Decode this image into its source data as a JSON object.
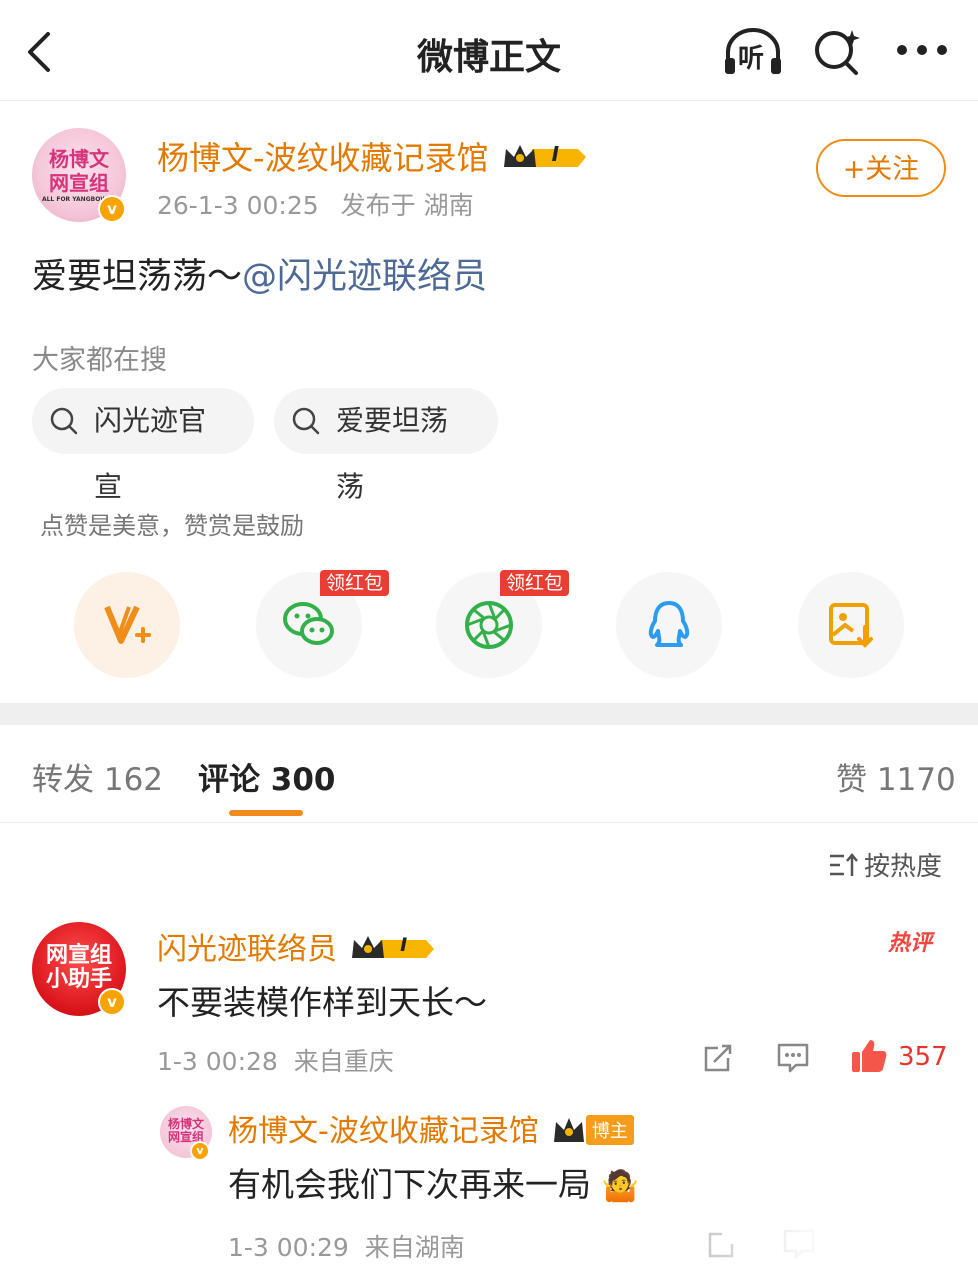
{
  "header": {
    "title": "微博正文",
    "listen_label": "听",
    "icons": [
      "back-arrow-icon",
      "listen-headphones-icon",
      "search-icon",
      "more-icon"
    ]
  },
  "post": {
    "author": "杨博文-波纹收藏记录馆",
    "avatar_text_line1": "杨博文",
    "avatar_text_line2": "网宣组",
    "avatar_text_line3": "ALL FOR YANGBOWEN",
    "verified_mark": "v",
    "level_badge": "I",
    "timestamp": "26-1-3 00:25",
    "location": "发布于 湖南",
    "follow_label": "+关注",
    "text": "爱要坦荡荡～",
    "mention": "@闪光迹联络员"
  },
  "search": {
    "label": "大家都在搜",
    "chips": [
      "闪光迹官宣",
      "爱要坦荡荡"
    ]
  },
  "reward": {
    "text": "点赞是美意，赞赏是鼓励",
    "red_packet_tag": "领红包",
    "buttons": [
      "reward-icon",
      "wechat-icon",
      "moments-icon",
      "qq-icon",
      "save-image-icon"
    ]
  },
  "tabs": {
    "repost": "转发 162",
    "comments": "评论 300",
    "likes": "赞 1170"
  },
  "sort_label": "按热度",
  "comments": [
    {
      "author": "闪光迹联络员",
      "avatar_text_line1": "网宣组",
      "avatar_text_line2": "小助手",
      "level_badge": "I",
      "hot_badge": "热评",
      "text": "不要装模作样到天长～",
      "meta": "1-3 00:28  来自重庆",
      "likes": "357",
      "reply": {
        "author": "杨博文-波纹收藏记录馆",
        "avatar_text_line1": "杨博文",
        "avatar_text_line2": "网宣组",
        "owner_badge": "博主",
        "text": "有机会我们下次再来一局",
        "emoji": "🤷",
        "meta": "1-3 00:29  来自湖南"
      }
    }
  ],
  "colors": {
    "accent_orange": "#e37a00",
    "link_blue": "#4d6a96",
    "red": "#e8352c"
  }
}
